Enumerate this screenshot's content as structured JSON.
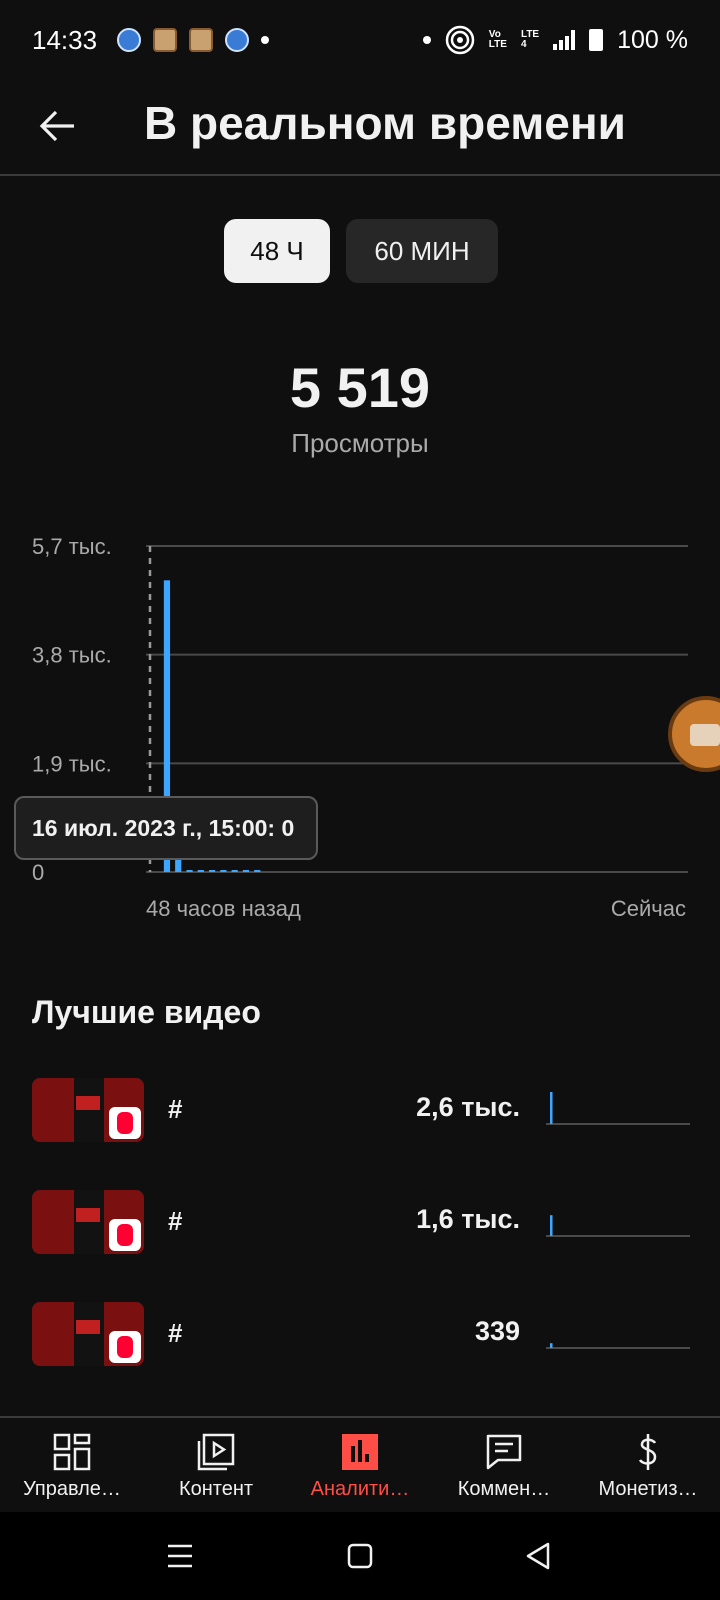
{
  "status_bar": {
    "time": "14:33",
    "network_top": "Vo",
    "network_bottom": "LTE",
    "network2_top": "LTE",
    "network2_bottom": "4",
    "battery": "100 %"
  },
  "header": {
    "title": "В реальном времени"
  },
  "period_toggle": {
    "options": [
      "48 Ч",
      "60 МИН"
    ],
    "selected": "48 Ч"
  },
  "metric": {
    "value": "5 519",
    "label": "Просмотры"
  },
  "chart_data": {
    "type": "bar",
    "y_tick_labels": [
      "5,7 тыс.",
      "3,8 тыс.",
      "1,9 тыс.",
      "0"
    ],
    "y_ticks": [
      5700,
      3800,
      1900,
      0
    ],
    "ylim": [
      0,
      5700
    ],
    "x_start_label": "48 часов назад",
    "x_end_label": "Сейчас",
    "bins": 48,
    "values": [
      0,
      5100,
      210,
      30,
      20,
      20,
      15,
      10,
      10,
      10,
      0,
      0,
      0,
      0,
      0,
      0,
      0,
      0,
      0,
      0,
      0,
      0,
      0,
      0,
      0,
      0,
      0,
      0,
      0,
      0,
      0,
      0,
      0,
      0,
      0,
      0,
      0,
      0,
      0,
      0,
      0,
      0,
      0,
      0,
      0,
      0,
      0,
      0
    ],
    "bar_color": "#3ea6ff",
    "grid": true,
    "selected_index": 0,
    "tooltip": "16 июл. 2023 г., 15:00: 0"
  },
  "best_videos": {
    "title": "Лучшие видео",
    "items": [
      {
        "title": "#",
        "views": "2,6 тыс.",
        "spark": 1.0
      },
      {
        "title": "#",
        "views": "1,6 тыс.",
        "spark": 0.65
      },
      {
        "title": "#",
        "views": "339",
        "spark": 0.15
      }
    ]
  },
  "bottom_nav": {
    "items": [
      {
        "label": "Управле…",
        "icon": "dashboard-icon"
      },
      {
        "label": "Контент",
        "icon": "content-icon"
      },
      {
        "label": "Аналити…",
        "icon": "analytics-icon"
      },
      {
        "label": "Коммен…",
        "icon": "comments-icon"
      },
      {
        "label": "Монетиз…",
        "icon": "monetization-icon"
      }
    ],
    "active_index": 2,
    "active_color": "#ff4e45"
  }
}
